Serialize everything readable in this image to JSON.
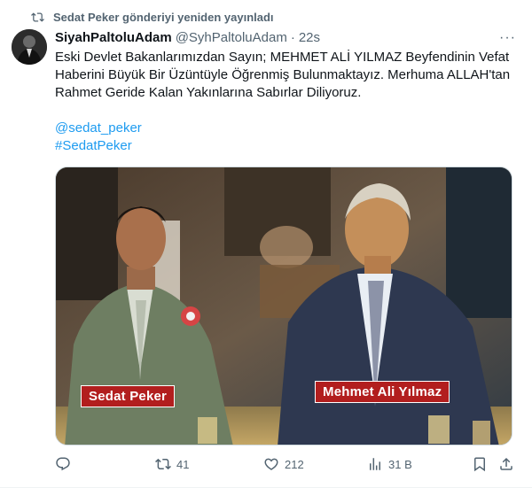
{
  "repost": {
    "text": "Sedat Peker gönderiyi yeniden yayınladı",
    "icon": "repost-icon"
  },
  "author": {
    "name": "SiyahPaltoluAdam",
    "handle": "@SyhPaltoluAdam",
    "separator": "·",
    "time": "22s"
  },
  "more": "···",
  "body": {
    "line1": "Eski Devlet Bakanlarımızdan Sayın; MEHMET ALİ YILMAZ Beyfendinin Vefat Haberini Büyük Bir Üzüntüyle Öğrenmiş Bulunmaktayız. Merhuma ALLAH'tan Rahmet Geride Kalan Yakınlarına Sabırlar Diliyoruz.",
    "mention": "@sedat_peker",
    "hashtag": "#SedatPeker"
  },
  "media": {
    "caption_left": "Sedat Peker",
    "caption_right": "Mehmet Ali Yılmaz"
  },
  "actions": {
    "reply": {
      "icon": "reply-icon",
      "count": ""
    },
    "retweet": {
      "icon": "retweet-icon",
      "count": "41"
    },
    "like": {
      "icon": "heart-icon",
      "count": "212"
    },
    "views": {
      "icon": "views-icon",
      "count": "31 B"
    },
    "bookmark": {
      "icon": "bookmark-icon"
    },
    "share": {
      "icon": "share-icon"
    }
  },
  "colors": {
    "accent": "#1d9bf0",
    "muted": "#536471",
    "text": "#0f1419",
    "caption_bg": "#b21e1e"
  }
}
